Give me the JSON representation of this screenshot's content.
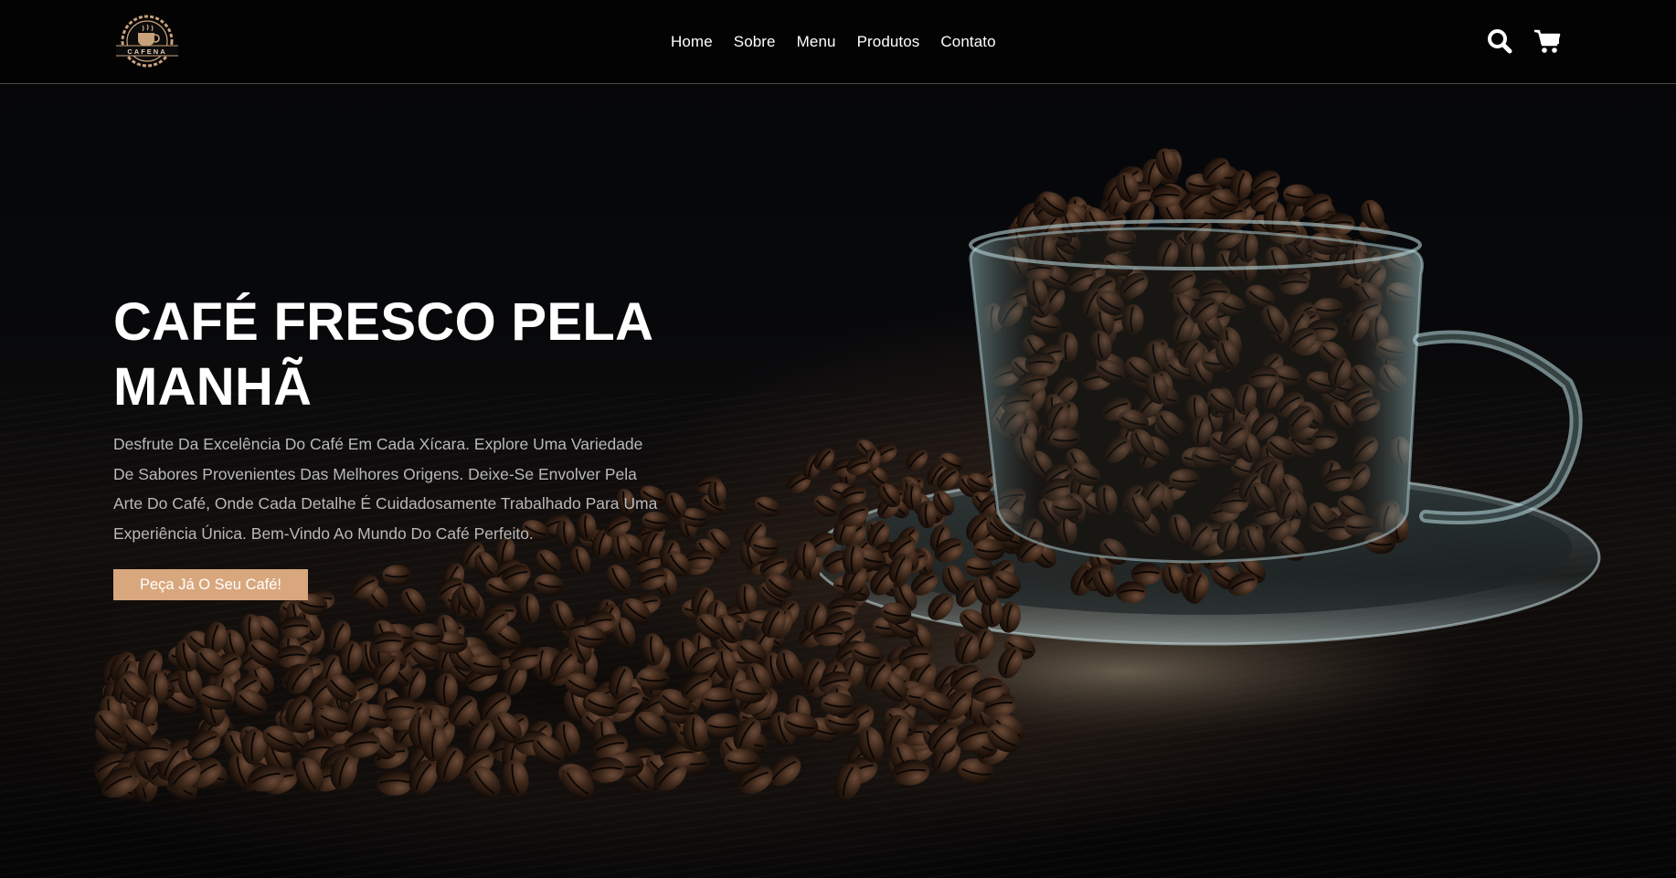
{
  "brand": {
    "logo_text": "CAFENA",
    "accent_color": "#d9a77d"
  },
  "nav": {
    "items": [
      {
        "label": "Home"
      },
      {
        "label": "Sobre"
      },
      {
        "label": "Menu"
      },
      {
        "label": "Produtos"
      },
      {
        "label": "Contato"
      }
    ]
  },
  "header_icons": {
    "search": "search-icon",
    "cart": "cart-icon"
  },
  "hero": {
    "title": "CAFÉ FRESCO PELA MANHÃ",
    "description": "Desfrute Da Excelência Do Café Em Cada Xícara. Explore Uma Variedade De Sabores Provenientes Das Melhores Origens. Deixe-Se Envolver Pela Arte Do Café, Onde Cada Detalhe É Cuidadosamente Trabalhado Para Uma Experiência Única. Bem-Vindo Ao Mundo Do Café Perfeito.",
    "cta_label": "Peça Já O Seu Café!",
    "image": "coffee-beans-glass-cup"
  }
}
